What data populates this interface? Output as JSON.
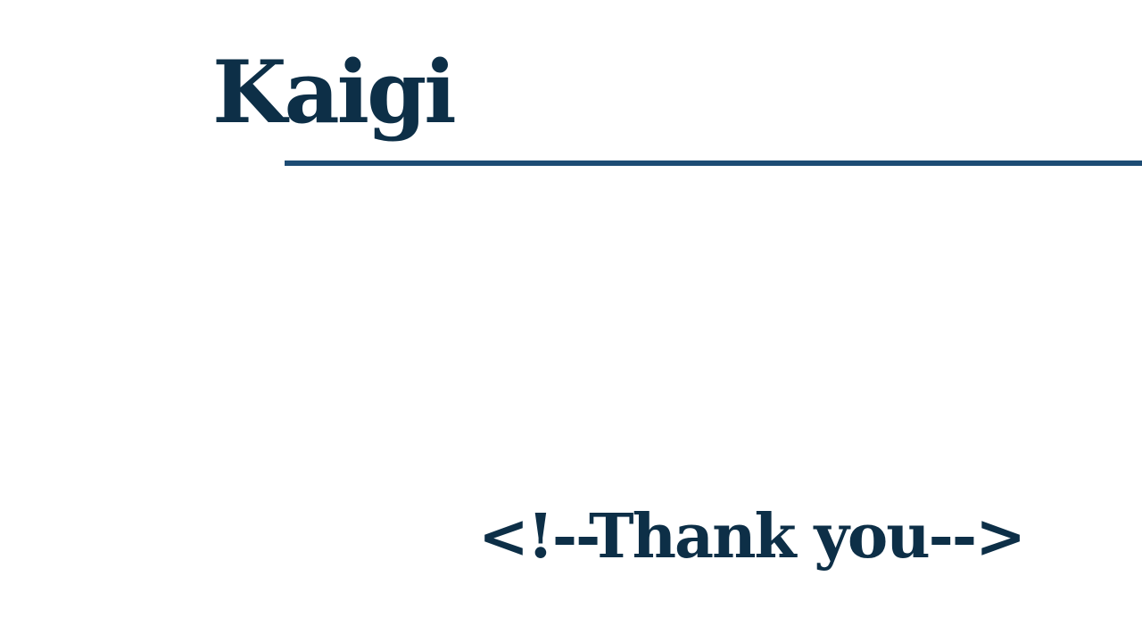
{
  "slide": {
    "logo_text": "Kaigi",
    "closing_text": "<!--Thank you-->"
  },
  "colors": {
    "text": "#0d2f47",
    "rule": "#1d4c74",
    "background": "#ffffff"
  }
}
